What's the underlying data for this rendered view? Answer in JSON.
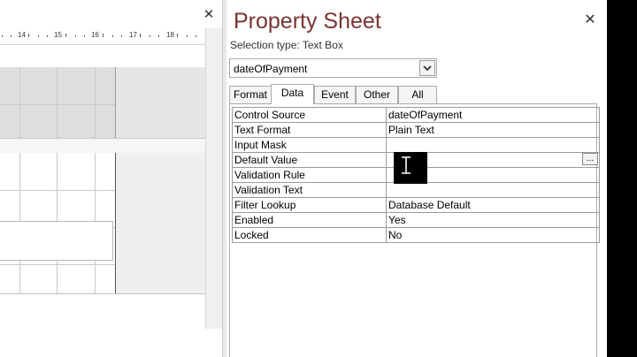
{
  "designer": {
    "close_glyph": "✕",
    "ruler_labels": [
      "14",
      "15",
      "16",
      "17",
      "18"
    ]
  },
  "property_sheet": {
    "title": "Property Sheet",
    "close_glyph": "✕",
    "selection_type_label": "Selection type:",
    "selection_type_value": "Text Box",
    "object_select_value": "dateOfPayment",
    "tabs": [
      {
        "label": "Format",
        "active": false
      },
      {
        "label": "Data",
        "active": true
      },
      {
        "label": "Event",
        "active": false
      },
      {
        "label": "Other",
        "active": false
      },
      {
        "label": "All",
        "active": false
      }
    ],
    "properties": [
      {
        "name": "Control Source",
        "value": "dateOfPayment"
      },
      {
        "name": "Text Format",
        "value": "Plain Text"
      },
      {
        "name": "Input Mask",
        "value": ""
      },
      {
        "name": "Default Value",
        "value": ""
      },
      {
        "name": "Validation Rule",
        "value": ""
      },
      {
        "name": "Validation Text",
        "value": ""
      },
      {
        "name": "Filter Lookup",
        "value": "Database Default"
      },
      {
        "name": "Enabled",
        "value": "Yes"
      },
      {
        "name": "Locked",
        "value": "No"
      }
    ],
    "build_button_label": "..."
  },
  "icons": {
    "dropdown": "chevron-down-icon",
    "close": "close-icon",
    "cursor": "text-cursor-icon"
  }
}
